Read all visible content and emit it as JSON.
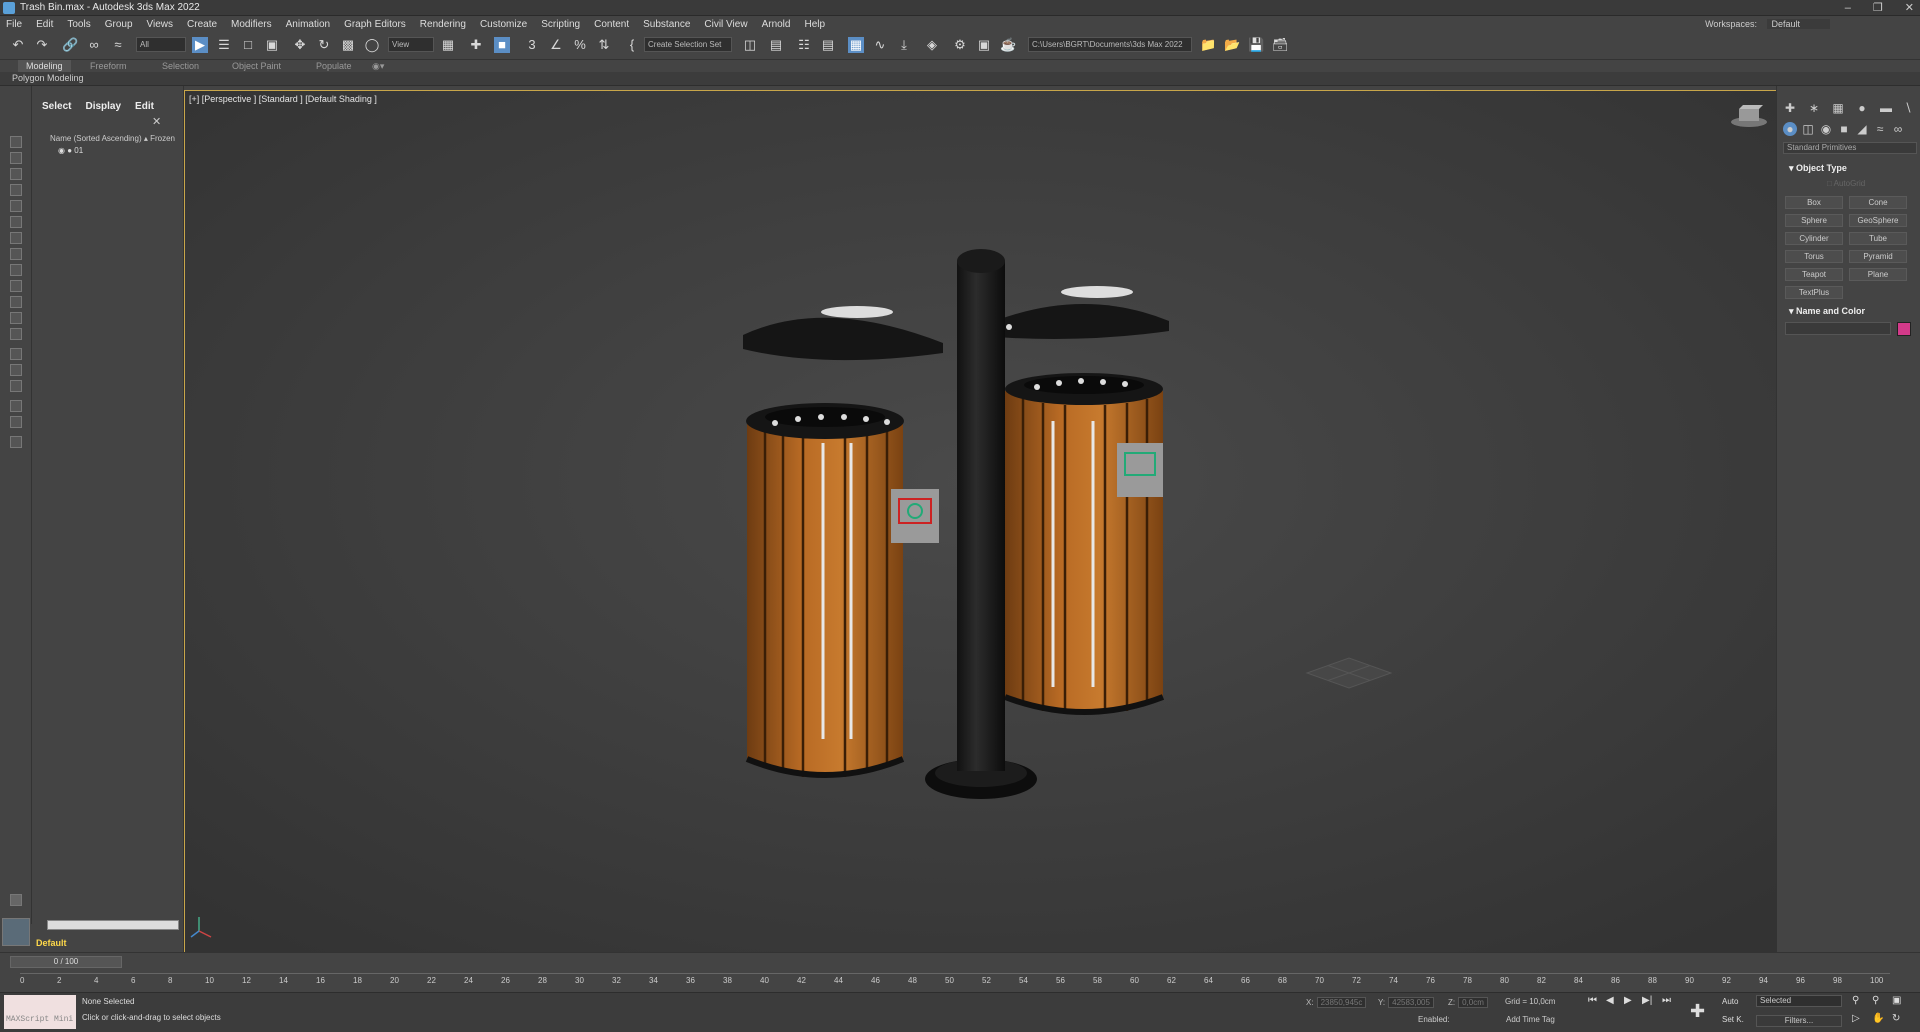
{
  "window": {
    "title": "Trash Bin.max - Autodesk 3ds Max 2022"
  },
  "menu": [
    "File",
    "Edit",
    "Tools",
    "Group",
    "Views",
    "Create",
    "Modifiers",
    "Animation",
    "Graph Editors",
    "Rendering",
    "Customize",
    "Scripting",
    "Content",
    "Substance",
    "Civil View",
    "Arnold",
    "Help"
  ],
  "workspace": {
    "label": "Workspaces:",
    "value": "Default"
  },
  "toolbar": {
    "filter": "All",
    "view": "View",
    "selection_set": "Create Selection Set",
    "path": "C:\\Users\\BGRT\\Documents\\3ds Max 2022"
  },
  "ribbon": {
    "tabs": [
      "Modeling",
      "Freeform",
      "Selection",
      "Object Paint",
      "Populate"
    ],
    "subtitle": "Polygon Modeling"
  },
  "scene_explorer": {
    "tabs": [
      "Select",
      "Display",
      "Edit"
    ],
    "column_header": "Name (Sorted Ascending) ▴ Frozen",
    "rows": [
      "01"
    ],
    "layer": "Default"
  },
  "viewport": {
    "label": "[+] [Perspective ] [Standard ] [Default Shading ]"
  },
  "command_panel": {
    "category": "Standard Primitives",
    "object_type_title": "Object Type",
    "autogrid": "AutoGrid",
    "primitives": [
      "Box",
      "Cone",
      "Sphere",
      "GeoSphere",
      "Cylinder",
      "Tube",
      "Torus",
      "Pyramid",
      "Teapot",
      "Plane",
      "TextPlus"
    ],
    "name_color_title": "Name and Color",
    "color": "#d33a8a"
  },
  "timeline": {
    "frame": "0 / 100",
    "ticks": [
      "0",
      "2",
      "4",
      "6",
      "8",
      "10",
      "12",
      "14",
      "16",
      "18",
      "20",
      "22",
      "24",
      "26",
      "28",
      "30",
      "32",
      "34",
      "36",
      "38",
      "40",
      "42",
      "44",
      "46",
      "48",
      "50",
      "52",
      "54",
      "56",
      "58",
      "60",
      "62",
      "64",
      "66",
      "68",
      "70",
      "72",
      "74",
      "76",
      "78",
      "80",
      "82",
      "84",
      "86",
      "88",
      "90",
      "92",
      "94",
      "96",
      "98",
      "100"
    ]
  },
  "status": {
    "maxscript": "MAXScript Mini",
    "line1": "None Selected",
    "line2": "Click or click-and-drag to select objects",
    "x_label": "X:",
    "x_value": "23850,945c",
    "y_label": "Y:",
    "y_value": "42583,005",
    "z_label": "Z:",
    "z_value": "0,0cm",
    "grid": "Grid = 10,0cm",
    "enabled": "Enabled:",
    "add_time_tag": "Add Time Tag",
    "auto": "Auto",
    "set_key": "Set K.",
    "selected": "Selected",
    "filters": "Filters..."
  }
}
